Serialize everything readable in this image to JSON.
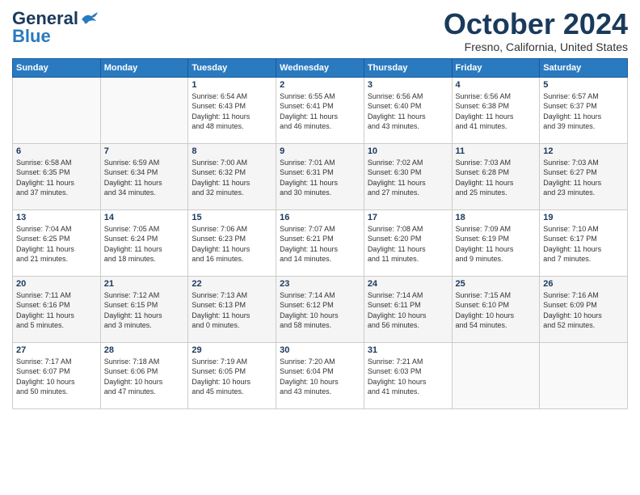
{
  "header": {
    "logo_line1": "General",
    "logo_line2": "Blue",
    "month_title": "October 2024",
    "location": "Fresno, California, United States"
  },
  "days_of_week": [
    "Sunday",
    "Monday",
    "Tuesday",
    "Wednesday",
    "Thursday",
    "Friday",
    "Saturday"
  ],
  "weeks": [
    [
      {
        "day": "",
        "content": ""
      },
      {
        "day": "",
        "content": ""
      },
      {
        "day": "1",
        "content": "Sunrise: 6:54 AM\nSunset: 6:43 PM\nDaylight: 11 hours\nand 48 minutes."
      },
      {
        "day": "2",
        "content": "Sunrise: 6:55 AM\nSunset: 6:41 PM\nDaylight: 11 hours\nand 46 minutes."
      },
      {
        "day": "3",
        "content": "Sunrise: 6:56 AM\nSunset: 6:40 PM\nDaylight: 11 hours\nand 43 minutes."
      },
      {
        "day": "4",
        "content": "Sunrise: 6:56 AM\nSunset: 6:38 PM\nDaylight: 11 hours\nand 41 minutes."
      },
      {
        "day": "5",
        "content": "Sunrise: 6:57 AM\nSunset: 6:37 PM\nDaylight: 11 hours\nand 39 minutes."
      }
    ],
    [
      {
        "day": "6",
        "content": "Sunrise: 6:58 AM\nSunset: 6:35 PM\nDaylight: 11 hours\nand 37 minutes."
      },
      {
        "day": "7",
        "content": "Sunrise: 6:59 AM\nSunset: 6:34 PM\nDaylight: 11 hours\nand 34 minutes."
      },
      {
        "day": "8",
        "content": "Sunrise: 7:00 AM\nSunset: 6:32 PM\nDaylight: 11 hours\nand 32 minutes."
      },
      {
        "day": "9",
        "content": "Sunrise: 7:01 AM\nSunset: 6:31 PM\nDaylight: 11 hours\nand 30 minutes."
      },
      {
        "day": "10",
        "content": "Sunrise: 7:02 AM\nSunset: 6:30 PM\nDaylight: 11 hours\nand 27 minutes."
      },
      {
        "day": "11",
        "content": "Sunrise: 7:03 AM\nSunset: 6:28 PM\nDaylight: 11 hours\nand 25 minutes."
      },
      {
        "day": "12",
        "content": "Sunrise: 7:03 AM\nSunset: 6:27 PM\nDaylight: 11 hours\nand 23 minutes."
      }
    ],
    [
      {
        "day": "13",
        "content": "Sunrise: 7:04 AM\nSunset: 6:25 PM\nDaylight: 11 hours\nand 21 minutes."
      },
      {
        "day": "14",
        "content": "Sunrise: 7:05 AM\nSunset: 6:24 PM\nDaylight: 11 hours\nand 18 minutes."
      },
      {
        "day": "15",
        "content": "Sunrise: 7:06 AM\nSunset: 6:23 PM\nDaylight: 11 hours\nand 16 minutes."
      },
      {
        "day": "16",
        "content": "Sunrise: 7:07 AM\nSunset: 6:21 PM\nDaylight: 11 hours\nand 14 minutes."
      },
      {
        "day": "17",
        "content": "Sunrise: 7:08 AM\nSunset: 6:20 PM\nDaylight: 11 hours\nand 11 minutes."
      },
      {
        "day": "18",
        "content": "Sunrise: 7:09 AM\nSunset: 6:19 PM\nDaylight: 11 hours\nand 9 minutes."
      },
      {
        "day": "19",
        "content": "Sunrise: 7:10 AM\nSunset: 6:17 PM\nDaylight: 11 hours\nand 7 minutes."
      }
    ],
    [
      {
        "day": "20",
        "content": "Sunrise: 7:11 AM\nSunset: 6:16 PM\nDaylight: 11 hours\nand 5 minutes."
      },
      {
        "day": "21",
        "content": "Sunrise: 7:12 AM\nSunset: 6:15 PM\nDaylight: 11 hours\nand 3 minutes."
      },
      {
        "day": "22",
        "content": "Sunrise: 7:13 AM\nSunset: 6:13 PM\nDaylight: 11 hours\nand 0 minutes."
      },
      {
        "day": "23",
        "content": "Sunrise: 7:14 AM\nSunset: 6:12 PM\nDaylight: 10 hours\nand 58 minutes."
      },
      {
        "day": "24",
        "content": "Sunrise: 7:14 AM\nSunset: 6:11 PM\nDaylight: 10 hours\nand 56 minutes."
      },
      {
        "day": "25",
        "content": "Sunrise: 7:15 AM\nSunset: 6:10 PM\nDaylight: 10 hours\nand 54 minutes."
      },
      {
        "day": "26",
        "content": "Sunrise: 7:16 AM\nSunset: 6:09 PM\nDaylight: 10 hours\nand 52 minutes."
      }
    ],
    [
      {
        "day": "27",
        "content": "Sunrise: 7:17 AM\nSunset: 6:07 PM\nDaylight: 10 hours\nand 50 minutes."
      },
      {
        "day": "28",
        "content": "Sunrise: 7:18 AM\nSunset: 6:06 PM\nDaylight: 10 hours\nand 47 minutes."
      },
      {
        "day": "29",
        "content": "Sunrise: 7:19 AM\nSunset: 6:05 PM\nDaylight: 10 hours\nand 45 minutes."
      },
      {
        "day": "30",
        "content": "Sunrise: 7:20 AM\nSunset: 6:04 PM\nDaylight: 10 hours\nand 43 minutes."
      },
      {
        "day": "31",
        "content": "Sunrise: 7:21 AM\nSunset: 6:03 PM\nDaylight: 10 hours\nand 41 minutes."
      },
      {
        "day": "",
        "content": ""
      },
      {
        "day": "",
        "content": ""
      }
    ]
  ]
}
